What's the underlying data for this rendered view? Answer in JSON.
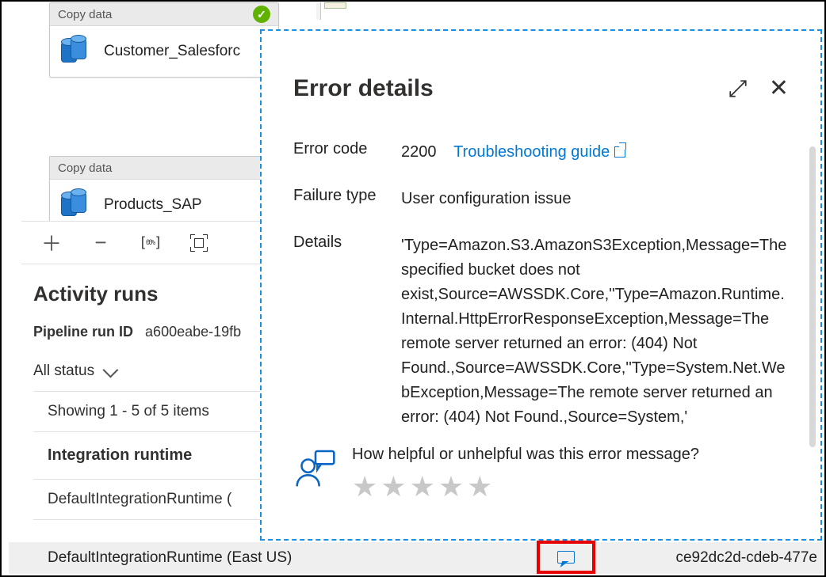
{
  "activities": {
    "card1": {
      "type_label": "Copy data",
      "name": "Customer_Salesforc"
    },
    "card2": {
      "type_label": "Copy data",
      "name": "Products_SAP"
    }
  },
  "activity_runs": {
    "heading": "Activity runs",
    "pipeline_run_id_label": "Pipeline run ID",
    "pipeline_run_id": "a600eabe-19fb",
    "status_filter": "All status",
    "showing": "Showing 1 - 5 of 5 items",
    "ir_heading": "Integration runtime",
    "rows": [
      "DefaultIntegrationRuntime (",
      "DefaultIntegrationRuntime (East US)"
    ],
    "run_id_partial": "ce92dc2d-cdeb-477e"
  },
  "popover": {
    "title": "Error details",
    "fields": {
      "error_code_label": "Error code",
      "error_code": "2200",
      "troubleshooting_link": "Troubleshooting guide",
      "failure_type_label": "Failure type",
      "failure_type": "User configuration issue",
      "details_label": "Details",
      "details": "'Type=Amazon.S3.AmazonS3Exception,Message=The specified bucket does not exist,Source=AWSSDK.Core,''Type=Amazon.Runtime.Internal.HttpErrorResponseException,Message=The remote server returned an error: (404) Not Found.,Source=AWSSDK.Core,''Type=System.Net.WebException,Message=The remote server returned an error: (404) Not Found.,Source=System,'"
    },
    "feedback_prompt": "How helpful or unhelpful was this error message?"
  }
}
